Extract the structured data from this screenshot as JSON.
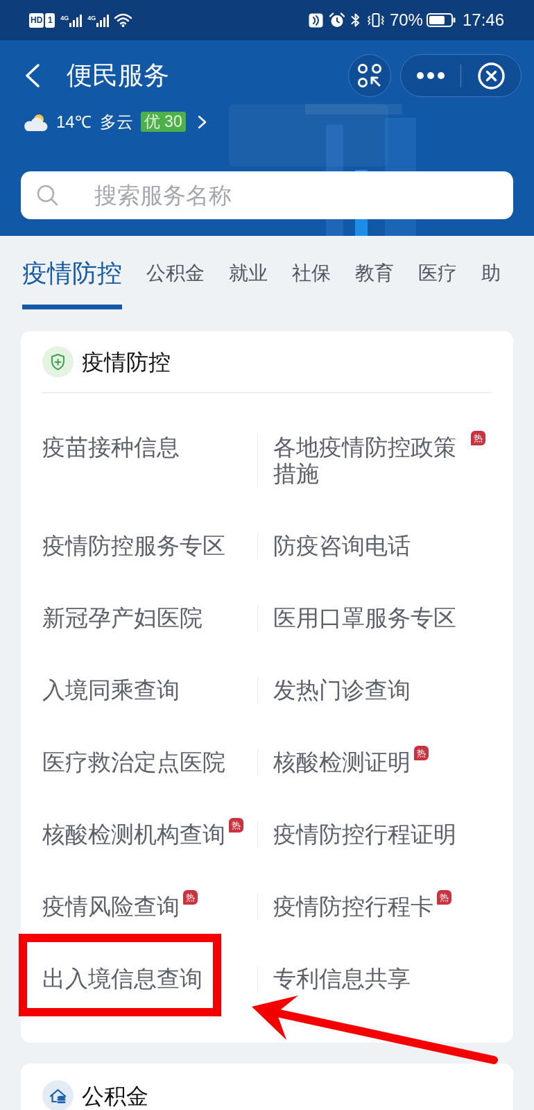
{
  "status_bar": {
    "hd": "HD",
    "sim": "1",
    "networks": [
      {
        "label": "4G"
      },
      {
        "label": "4G"
      }
    ],
    "battery": "70%",
    "time": "17:46"
  },
  "header": {
    "title": "便民服务",
    "weather": {
      "temperature": "14℃",
      "condition": "多云",
      "air_quality": "优 30"
    }
  },
  "search": {
    "placeholder": "搜索服务名称"
  },
  "tabs": [
    {
      "label": "疫情防控",
      "selected": true
    },
    {
      "label": "公积金",
      "selected": false
    },
    {
      "label": "就业",
      "selected": false
    },
    {
      "label": "社保",
      "selected": false
    },
    {
      "label": "教育",
      "selected": false
    },
    {
      "label": "医疗",
      "selected": false
    },
    {
      "label": "助",
      "selected": false
    }
  ],
  "sections": [
    {
      "kind": "epidemic",
      "title": "疫情防控",
      "items": [
        {
          "label": "疫苗接种信息",
          "highlighted": false
        },
        {
          "label": "各地疫情防控政策措施",
          "badge": "热",
          "highlighted": false
        },
        {
          "label": "疫情防控服务专区",
          "highlighted": false
        },
        {
          "label": "防疫咨询电话",
          "highlighted": false
        },
        {
          "label": "新冠孕产妇医院",
          "highlighted": false
        },
        {
          "label": "医用口罩服务专区",
          "highlighted": false
        },
        {
          "label": "入境同乘查询",
          "highlighted": false
        },
        {
          "label": "发热门诊查询",
          "highlighted": false
        },
        {
          "label": "医疗救治定点医院",
          "highlighted": false
        },
        {
          "label": "核酸检测证明",
          "badge": "热",
          "highlighted": false
        },
        {
          "label": "核酸检测机构查询",
          "badge": "热",
          "highlighted": false
        },
        {
          "label": "疫情防控行程证明",
          "highlighted": false
        },
        {
          "label": "疫情风险查询",
          "badge": "热",
          "highlighted": false
        },
        {
          "label": "疫情防控行程卡",
          "badge": "热",
          "highlighted": false
        },
        {
          "label": "出入境信息查询",
          "highlighted": true
        },
        {
          "label": "专利信息共享",
          "highlighted": false
        }
      ]
    },
    {
      "kind": "fund",
      "title": "公积金"
    }
  ]
}
